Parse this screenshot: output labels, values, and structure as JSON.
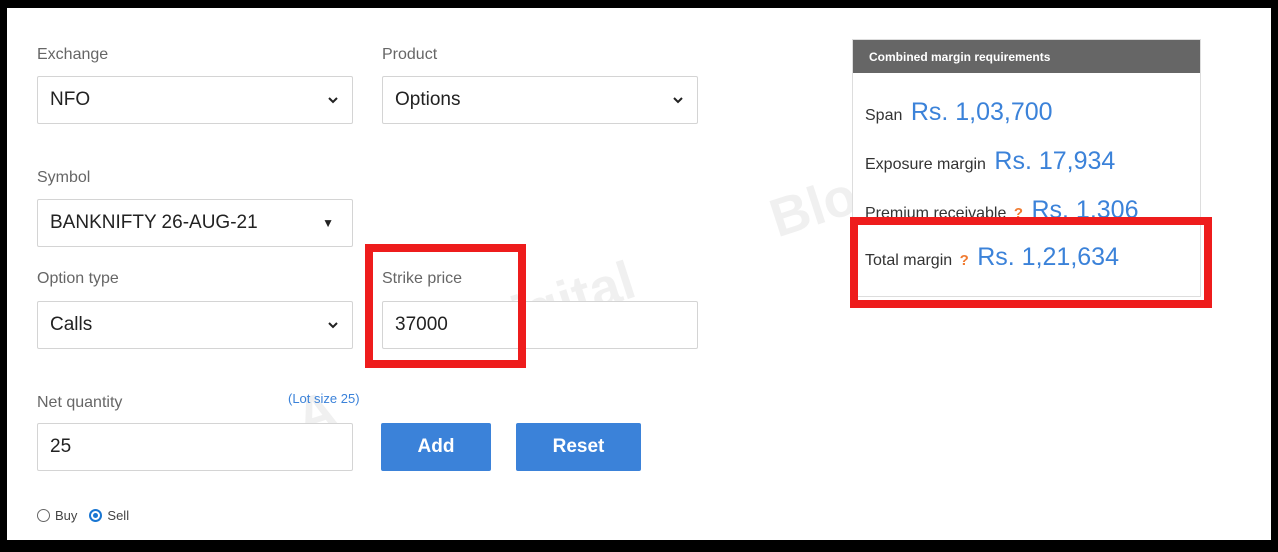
{
  "form": {
    "exchange": {
      "label": "Exchange",
      "value": "NFO"
    },
    "product": {
      "label": "Product",
      "value": "Options"
    },
    "symbol": {
      "label": "Symbol",
      "value": "BANKNIFTY 26-AUG-21"
    },
    "option_type": {
      "label": "Option type",
      "value": "Calls"
    },
    "strike_price": {
      "label": "Strike price",
      "value": "37000"
    },
    "net_quantity": {
      "label": "Net quantity",
      "value": "25",
      "lot_size": "(Lot size 25)"
    },
    "add_label": "Add",
    "reset_label": "Reset",
    "side": {
      "buy_label": "Buy",
      "sell_label": "Sell",
      "selected": "Sell"
    }
  },
  "margin_panel": {
    "title": "Combined margin requirements",
    "span": {
      "label": "Span",
      "amount": "Rs. 1,03,700"
    },
    "exposure": {
      "label": "Exposure margin",
      "amount": "Rs. 17,934"
    },
    "premium": {
      "label": "Premium receivable",
      "help": "?",
      "amount": "Rs. 1,306"
    },
    "total": {
      "label": "Total margin",
      "help": "?",
      "amount": "Rs. 1,21,634"
    }
  },
  "watermark": {
    "line1": "Blogger",
    "line2": "Digital",
    "line3": "A"
  },
  "colors": {
    "accent": "#3b82d9",
    "highlight": "#ee1c1c",
    "panel_header": "#666666",
    "help": "#f07a30"
  }
}
